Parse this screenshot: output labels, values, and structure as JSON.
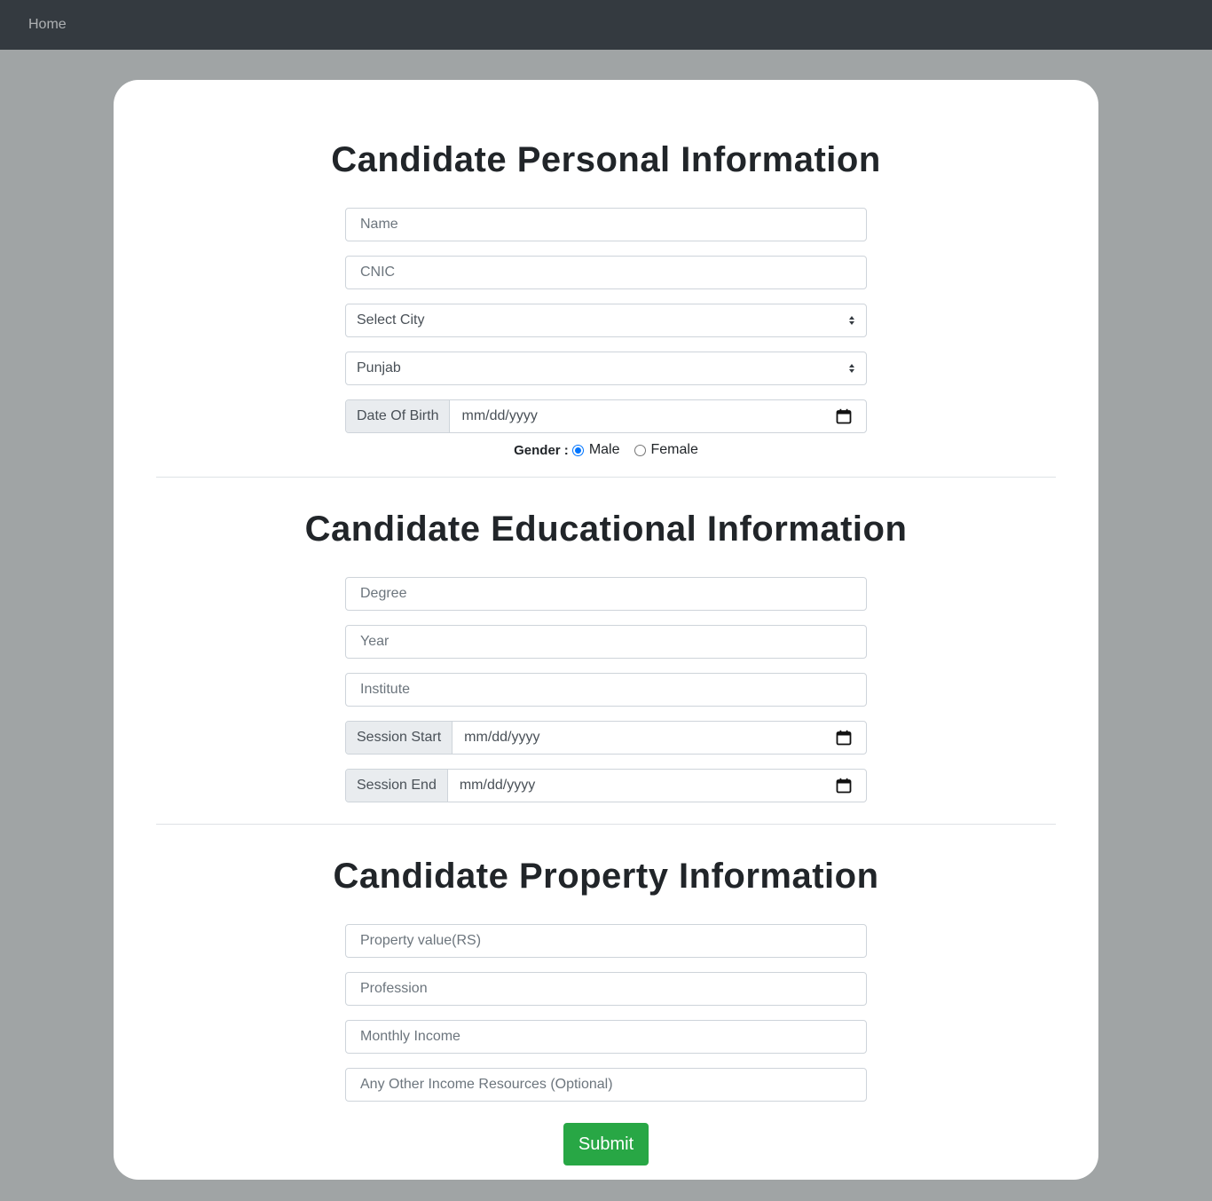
{
  "nav": {
    "home": "Home"
  },
  "personal": {
    "title": "Candidate Personal Information",
    "name_placeholder": "Name",
    "cnic_placeholder": "CNIC",
    "city_selected": "Select City",
    "province_selected": "Punjab",
    "dob_label": "Date Of Birth",
    "date_placeholder": "mm/dd/yyyy",
    "gender_label": "Gender :",
    "gender_options": [
      "Male",
      "Female"
    ],
    "gender_selected": "Male"
  },
  "education": {
    "title": "Candidate Educational Information",
    "degree_placeholder": "Degree",
    "year_placeholder": "Year",
    "institute_placeholder": "Institute",
    "session_start_label": "Session Start",
    "session_end_label": "Session End",
    "date_placeholder": "mm/dd/yyyy"
  },
  "property": {
    "title": "Candidate Property Information",
    "property_value_placeholder": "Property value(RS)",
    "profession_placeholder": "Profession",
    "monthly_income_placeholder": "Monthly Income",
    "other_income_placeholder": "Any Other Income Resources (Optional)"
  },
  "submit_label": "Submit",
  "colors": {
    "navbar": "#343a40",
    "page_bg": "#a0a4a5",
    "submit": "#28a745",
    "radio_accent": "#0075ff"
  }
}
